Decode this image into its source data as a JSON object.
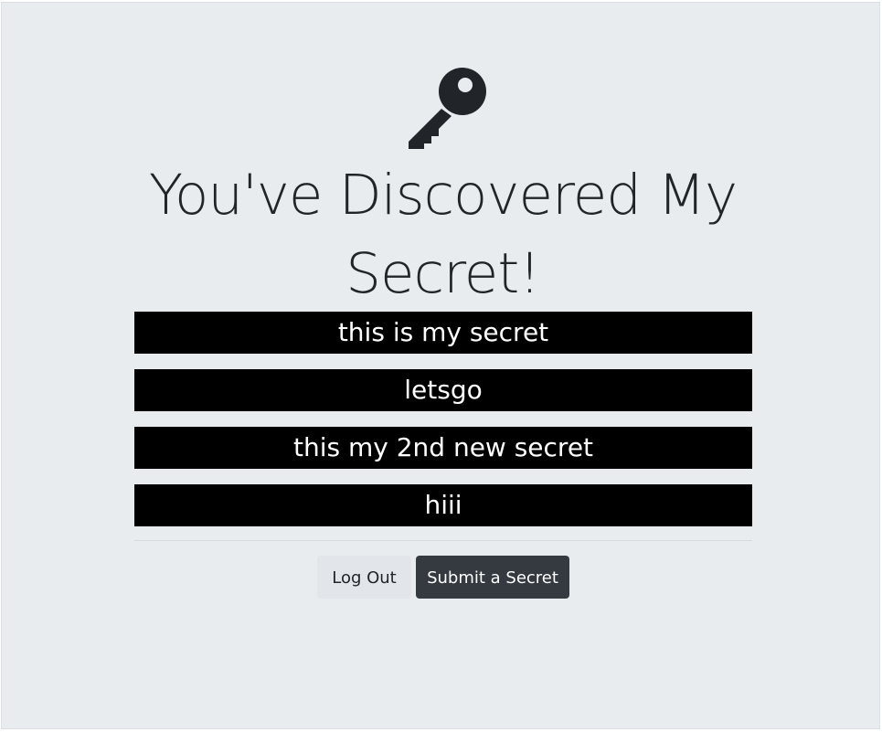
{
  "icon": {
    "name": "key-icon",
    "color": "#212529"
  },
  "title": "You've Discovered My Secret!",
  "secrets": [
    "this is my secret",
    "letsgo",
    "this my 2nd new secret",
    "hiii"
  ],
  "buttons": {
    "logout": "Log Out",
    "submit": "Submit a Secret"
  },
  "colors": {
    "background": "#e9ecef",
    "secret_bar": "#000000",
    "secret_text": "#ffffff",
    "dark_button": "#343a40",
    "light_button": "#e2e5e9"
  }
}
